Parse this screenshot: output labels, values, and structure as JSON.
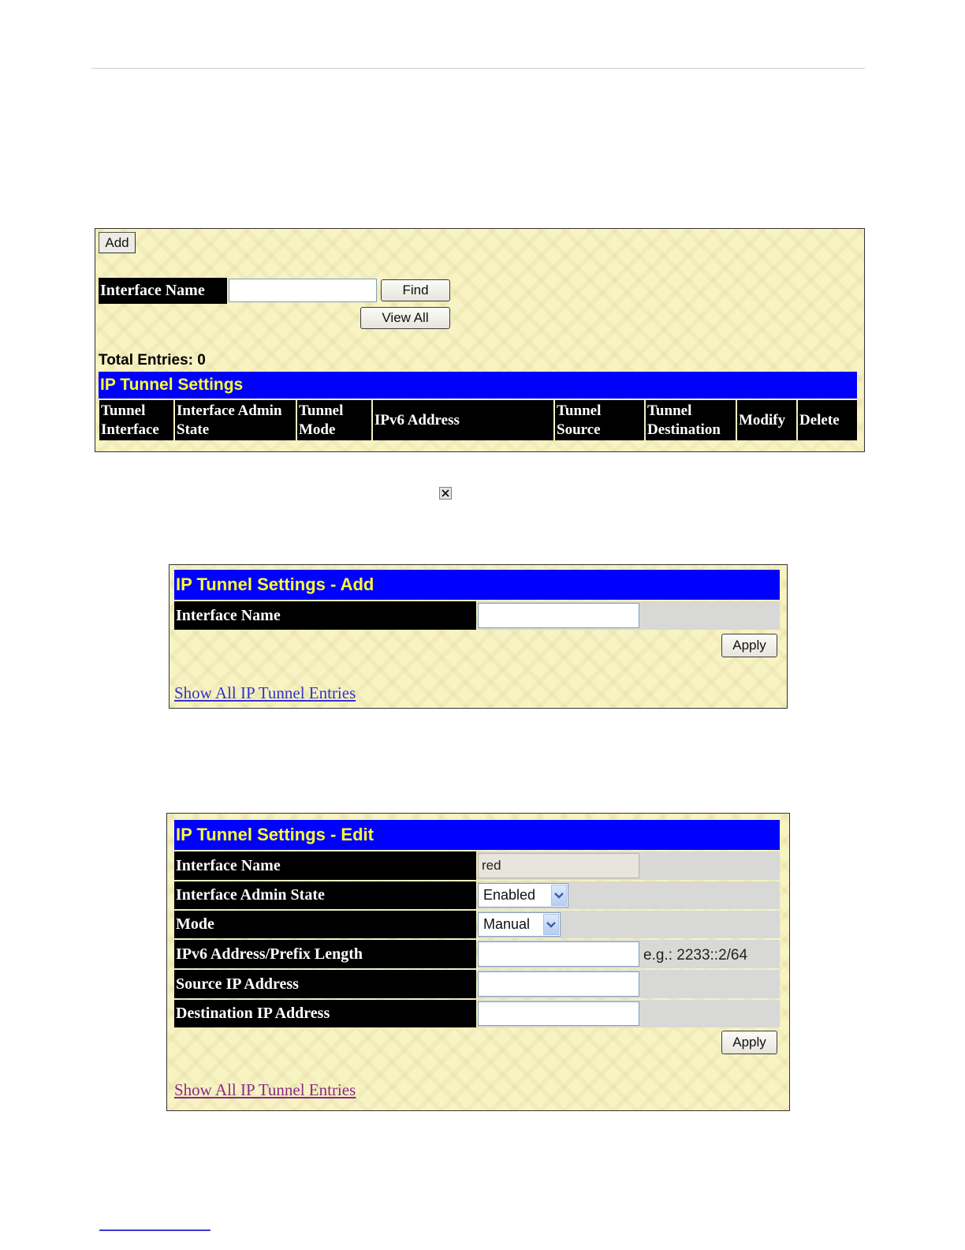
{
  "colors": {
    "panel_bg": "#f7f3c2",
    "header_bar": "#0000ff",
    "header_text": "#ffff33",
    "label_bg": "#000000",
    "label_text": "#ffffff",
    "link": "#3333cc",
    "link_visited": "#8a2a8a"
  },
  "inline_icon": "close-x-icon",
  "list_panel": {
    "add_label": "Add",
    "interface_name_label": "Interface Name",
    "interface_name_value": "",
    "find_label": "Find",
    "view_all_label": "View All",
    "total_entries": "Total Entries: 0",
    "title": "IP Tunnel Settings",
    "columns": [
      {
        "line1": "Tunnel",
        "line2": "Interface"
      },
      {
        "line1": "Interface Admin",
        "line2": "State"
      },
      {
        "line1": "Tunnel",
        "line2": "Mode"
      },
      {
        "line1": "IPv6 Address",
        "line2": ""
      },
      {
        "line1": "Tunnel",
        "line2": "Source"
      },
      {
        "line1": "Tunnel",
        "line2": "Destination"
      },
      {
        "line1": "Modify",
        "line2": ""
      },
      {
        "line1": "Delete",
        "line2": ""
      }
    ]
  },
  "add_panel": {
    "title": "IP Tunnel Settings - Add",
    "interface_name_label": "Interface Name",
    "interface_name_value": "",
    "apply_label": "Apply",
    "show_all_link": "Show All IP Tunnel Entries"
  },
  "edit_panel": {
    "title": "IP Tunnel Settings - Edit",
    "interface_name_label": "Interface Name",
    "interface_name_value": "red",
    "admin_state_label": "Interface Admin State",
    "admin_state_value": "Enabled",
    "mode_label": "Mode",
    "mode_value": "Manual",
    "ipv6_label": "IPv6 Address/Prefix Length",
    "ipv6_value": "",
    "ipv6_hint": "e.g.: 2233::2/64",
    "source_label": "Source IP Address",
    "source_value": "",
    "destination_label": "Destination IP Address",
    "destination_value": "",
    "apply_label": "Apply",
    "show_all_link": "Show All IP Tunnel Entries"
  }
}
